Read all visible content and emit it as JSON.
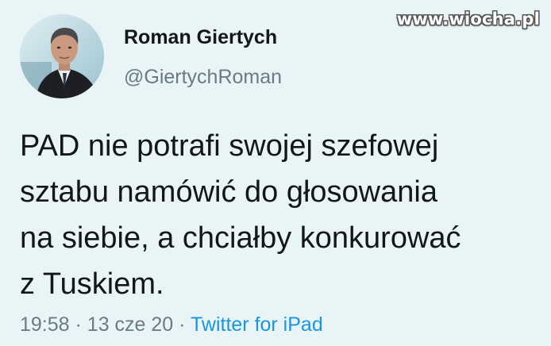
{
  "watermark": "www.wiocha.pl",
  "author": {
    "name": "Roman Giertych",
    "handle": "@GiertychRoman"
  },
  "tweet": {
    "lines": [
      "PAD nie potrafi swojej szefowej",
      "sztabu namówić do głosowania",
      "na siebie, a chciałby konkurować",
      "z Tuskiem."
    ]
  },
  "meta": {
    "time": "19:58",
    "separator": "·",
    "date": "13 cze 20",
    "source": "Twitter for iPad"
  },
  "colors": {
    "background": "#e8f4f6",
    "text": "#14171a",
    "secondary": "#687b86",
    "link": "#1b95e0"
  }
}
